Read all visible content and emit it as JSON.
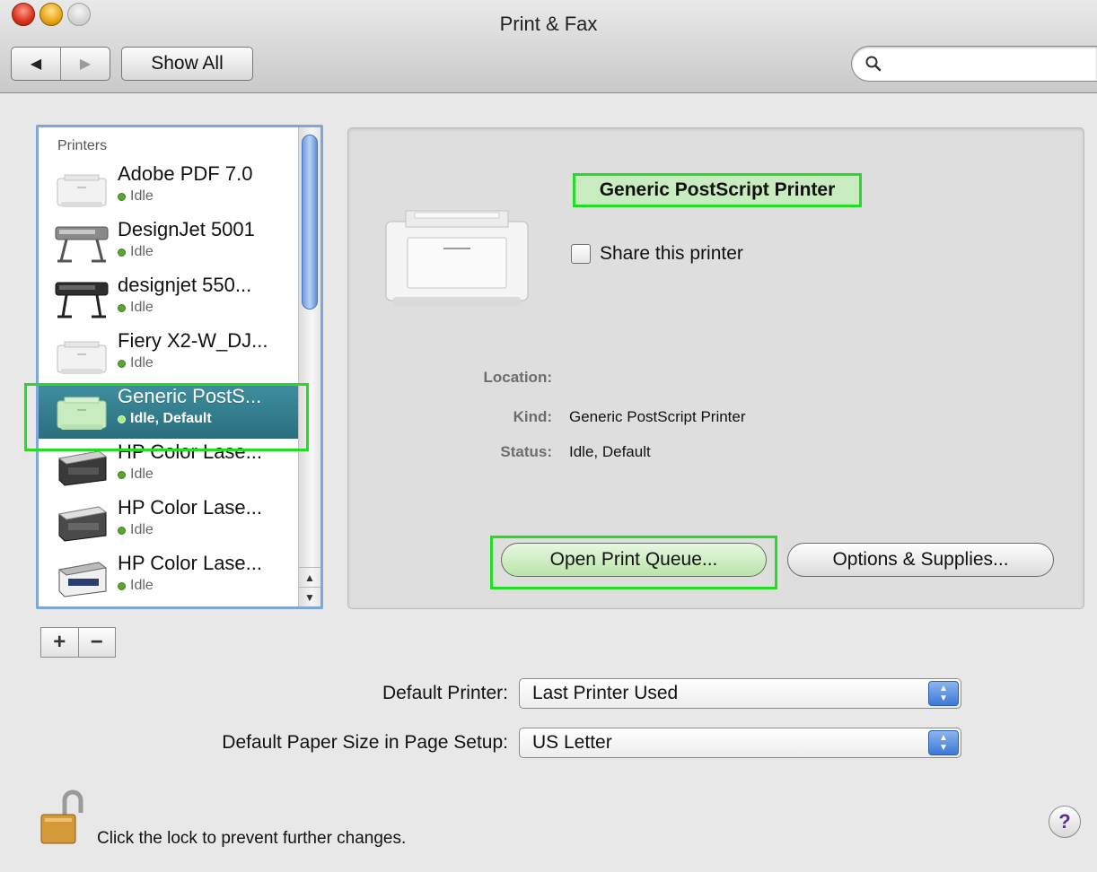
{
  "window": {
    "title": "Print & Fax"
  },
  "toolbar": {
    "back_icon": "back-arrow-icon",
    "forward_icon": "forward-arrow-icon",
    "show_all_label": "Show All",
    "search_placeholder": ""
  },
  "sidebar": {
    "header": "Printers",
    "printers": [
      {
        "name": "Adobe PDF 7.0",
        "status": "Idle",
        "icon": "laser-printer-icon",
        "selected": false
      },
      {
        "name": "DesignJet 5001",
        "status": "Idle",
        "icon": "plotter-printer-icon",
        "selected": false
      },
      {
        "name": "designjet 550...",
        "status": "Idle",
        "icon": "plotter-printer-icon",
        "selected": false
      },
      {
        "name": "Fiery X2-W_DJ...",
        "status": "Idle",
        "icon": "laser-printer-icon",
        "selected": false
      },
      {
        "name": "Generic PostS...",
        "status": "Idle, Default",
        "icon": "laser-printer-icon",
        "selected": true
      },
      {
        "name": "HP Color Lase...",
        "status": "Idle",
        "icon": "color-laser-printer-icon",
        "selected": false
      },
      {
        "name": "HP Color Lase...",
        "status": "Idle",
        "icon": "color-laser-printer-icon",
        "selected": false
      },
      {
        "name": "HP Color Lase...",
        "status": "Idle",
        "icon": "color-laser-printer-icon",
        "selected": false
      }
    ],
    "add_label": "+",
    "remove_label": "−"
  },
  "details": {
    "printer_name": "Generic PostScript Printer",
    "share_label": "Share this printer",
    "share_checked": false,
    "location_label": "Location:",
    "location_value": "",
    "kind_label": "Kind:",
    "kind_value": "Generic PostScript Printer",
    "status_label": "Status:",
    "status_value": "Idle, Default",
    "open_queue_label": "Open Print Queue...",
    "options_label": "Options & Supplies..."
  },
  "defaults": {
    "default_printer_label": "Default Printer:",
    "default_printer_value": "Last Printer Used",
    "paper_size_label": "Default Paper Size in Page Setup:",
    "paper_size_value": "US Letter"
  },
  "footer": {
    "lock_text": "Click the lock to prevent further changes.",
    "help_label": "?"
  },
  "colors": {
    "selection": "#2f7a8a",
    "highlight": "#22dd22",
    "status_idle": "#5aa630",
    "scroll_thumb": "#6b9ae2"
  }
}
